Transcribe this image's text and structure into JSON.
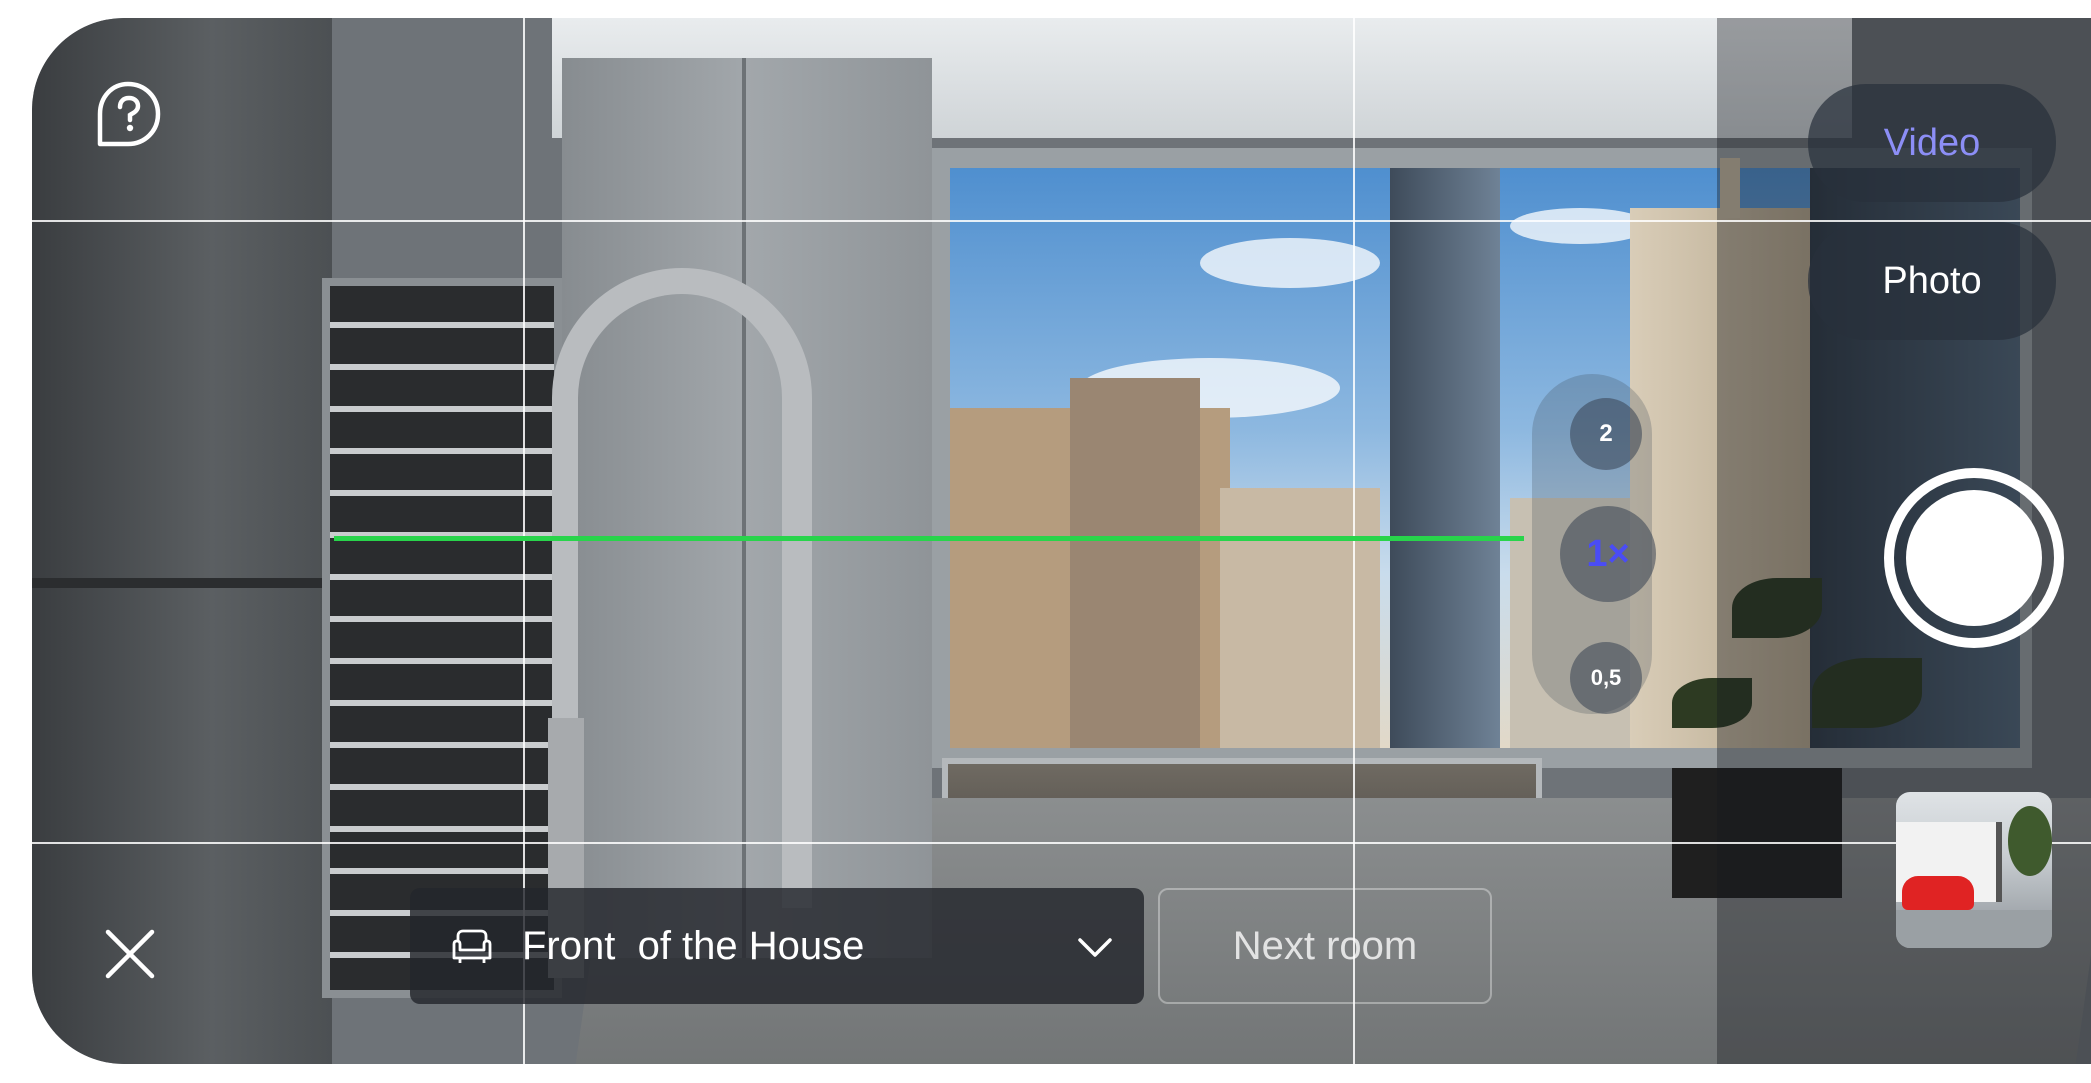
{
  "camera": {
    "mode_options": [
      {
        "label": "Video",
        "selected": true
      },
      {
        "label": "Photo",
        "selected": false
      }
    ],
    "zoom_levels": [
      {
        "label": "2",
        "selected": false
      },
      {
        "label": "1×",
        "selected": true
      },
      {
        "label": "0,5",
        "selected": false
      }
    ],
    "room_selector": {
      "label": "Front  of the House",
      "icon": "sofa-icon"
    },
    "next_room_label": "Next room",
    "icons": {
      "help": "help-bubble-icon",
      "close": "close-icon",
      "chevron": "chevron-down-icon"
    },
    "colors": {
      "level_line": "#28d44b",
      "selected_mode_text": "#8c8ef6",
      "selected_zoom_text": "#4a4cf5"
    }
  }
}
